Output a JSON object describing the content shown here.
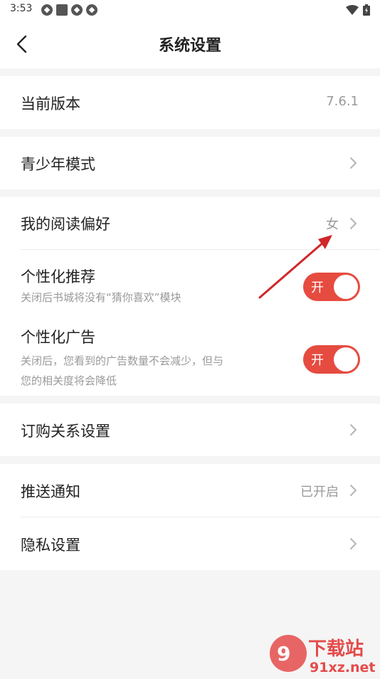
{
  "status_bar": {
    "time": "3:53"
  },
  "header": {
    "title": "系统设置"
  },
  "settings": {
    "version": {
      "label": "当前版本",
      "value": "7.6.1"
    },
    "youth_mode": {
      "label": "青少年模式"
    },
    "reading_pref": {
      "label": "我的阅读偏好",
      "value": "女"
    },
    "personal_rec": {
      "label": "个性化推荐",
      "desc": "关闭后书城将没有“猜你喜欢”模块",
      "toggle": "开"
    },
    "personal_ads": {
      "label": "个性化广告",
      "desc_line1": "关闭后，您看到的广告数量不会减少，但与",
      "desc_line2": "您的相关度将会降低",
      "toggle": "开"
    },
    "subscription": {
      "label": "订购关系设置"
    },
    "push": {
      "label": "推送通知",
      "value": "已开启"
    },
    "privacy": {
      "label": "隐私设置"
    }
  },
  "watermark": {
    "text_top": "下载站",
    "text_bottom": "91xz.net"
  },
  "colors": {
    "accent": "#e64b40",
    "arrow": "#d0262a",
    "background": "#f5f5f5"
  }
}
